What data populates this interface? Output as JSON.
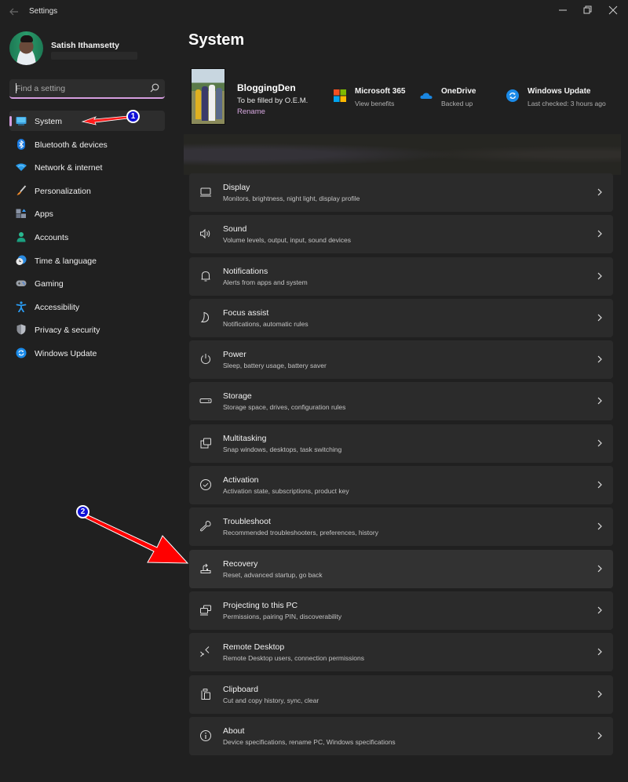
{
  "window": {
    "title": "Settings",
    "controls": {
      "minimize": "—",
      "maximize": "❐",
      "close": "✕"
    }
  },
  "profile": {
    "name": "Satish Ithamsetty"
  },
  "search": {
    "placeholder": "Find a setting",
    "value": ""
  },
  "sidebar": {
    "items": [
      {
        "label": "System",
        "icon": "system-icon",
        "active": true
      },
      {
        "label": "Bluetooth & devices",
        "icon": "bluetooth-icon"
      },
      {
        "label": "Network & internet",
        "icon": "network-icon"
      },
      {
        "label": "Personalization",
        "icon": "personalization-icon"
      },
      {
        "label": "Apps",
        "icon": "apps-icon"
      },
      {
        "label": "Accounts",
        "icon": "accounts-icon"
      },
      {
        "label": "Time & language",
        "icon": "time-language-icon"
      },
      {
        "label": "Gaming",
        "icon": "gaming-icon"
      },
      {
        "label": "Accessibility",
        "icon": "accessibility-icon"
      },
      {
        "label": "Privacy & security",
        "icon": "privacy-shield-icon"
      },
      {
        "label": "Windows Update",
        "icon": "windows-update-icon"
      }
    ]
  },
  "main": {
    "title": "System",
    "device": {
      "name": "BloggingDen",
      "model": "To be filled by O.E.M.",
      "rename_label": "Rename"
    },
    "quick_links": [
      {
        "title": "Microsoft 365",
        "subtitle": "View benefits",
        "icon": "microsoft-logo-icon"
      },
      {
        "title": "OneDrive",
        "subtitle": "Backed up",
        "icon": "onedrive-cloud-icon"
      },
      {
        "title": "Windows Update",
        "subtitle": "Last checked: 3 hours ago",
        "icon": "windows-update-icon"
      }
    ],
    "settings": [
      {
        "title": "Display",
        "subtitle": "Monitors, brightness, night light, display profile",
        "icon": "display-icon"
      },
      {
        "title": "Sound",
        "subtitle": "Volume levels, output, input, sound devices",
        "icon": "sound-icon"
      },
      {
        "title": "Notifications",
        "subtitle": "Alerts from apps and system",
        "icon": "bell-icon"
      },
      {
        "title": "Focus assist",
        "subtitle": "Notifications, automatic rules",
        "icon": "moon-icon"
      },
      {
        "title": "Power",
        "subtitle": "Sleep, battery usage, battery saver",
        "icon": "power-icon"
      },
      {
        "title": "Storage",
        "subtitle": "Storage space, drives, configuration rules",
        "icon": "storage-icon"
      },
      {
        "title": "Multitasking",
        "subtitle": "Snap windows, desktops, task switching",
        "icon": "multitasking-icon"
      },
      {
        "title": "Activation",
        "subtitle": "Activation state, subscriptions, product key",
        "icon": "activation-check-icon"
      },
      {
        "title": "Troubleshoot",
        "subtitle": "Recommended troubleshooters, preferences, history",
        "icon": "wrench-icon"
      },
      {
        "title": "Recovery",
        "subtitle": "Reset, advanced startup, go back",
        "icon": "recovery-icon"
      },
      {
        "title": "Projecting to this PC",
        "subtitle": "Permissions, pairing PIN, discoverability",
        "icon": "projecting-icon"
      },
      {
        "title": "Remote Desktop",
        "subtitle": "Remote Desktop users, connection permissions",
        "icon": "remote-desktop-icon"
      },
      {
        "title": "Clipboard",
        "subtitle": "Cut and copy history, sync, clear",
        "icon": "clipboard-icon"
      },
      {
        "title": "About",
        "subtitle": "Device specifications, rename PC, Windows specifications",
        "icon": "info-icon"
      }
    ]
  },
  "annotations": {
    "step1": "1",
    "step2": "2"
  },
  "colors": {
    "accent": "#d59ddf",
    "background": "#202020",
    "card": "#2b2b2b",
    "annotation_arrow": "#ff0000",
    "annotation_badge": "#1010d8"
  }
}
